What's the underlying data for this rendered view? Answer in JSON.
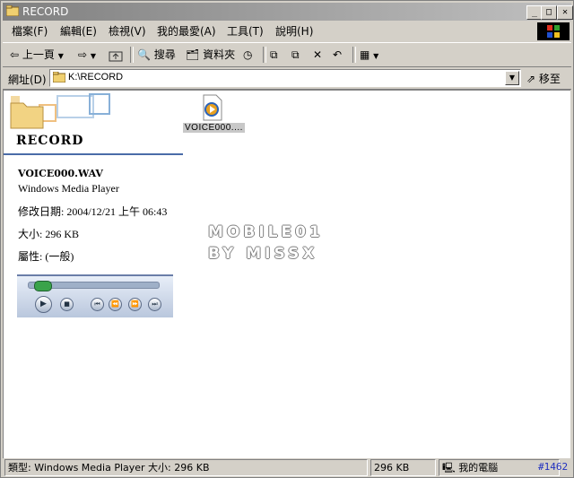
{
  "window": {
    "title": "RECORD"
  },
  "titlebar_buttons": {
    "minimize": "_",
    "maximize": "□",
    "close": "✕"
  },
  "menu": [
    {
      "label": "檔案(F)"
    },
    {
      "label": "編輯(E)"
    },
    {
      "label": "檢視(V)"
    },
    {
      "label": "我的最愛(A)"
    },
    {
      "label": "工具(T)"
    },
    {
      "label": "說明(H)"
    }
  ],
  "toolbar": {
    "back_label": "上一頁",
    "search_label": "搜尋",
    "folders_label": "資料夾"
  },
  "address": {
    "label": "網址(D)",
    "value": "K:\\RECORD",
    "go_label": "移至"
  },
  "left_panel": {
    "folder_title": "RECORD",
    "file_name": "VOICE000.WAV",
    "file_type": "Windows Media Player",
    "modified": "修改日期: 2004/12/21 上午 06:43",
    "size": "大小: 296 KB",
    "attributes": "屬性: (一般)"
  },
  "player": {
    "progress": 0.05
  },
  "files": [
    {
      "label": "VOICE000...."
    }
  ],
  "watermark": {
    "line1": "MOBILE01",
    "line2": "BY MISSX"
  },
  "status": {
    "type_text": "類型: Windows Media Player 大小: 296 KB",
    "size_text": "296 KB",
    "location_text": "我的電腦"
  },
  "badge": "#1462",
  "colors": {
    "title_gradient_start": "#808080",
    "selection_bg": "#c8c8c8",
    "accent_line": "#4a6ca8"
  }
}
